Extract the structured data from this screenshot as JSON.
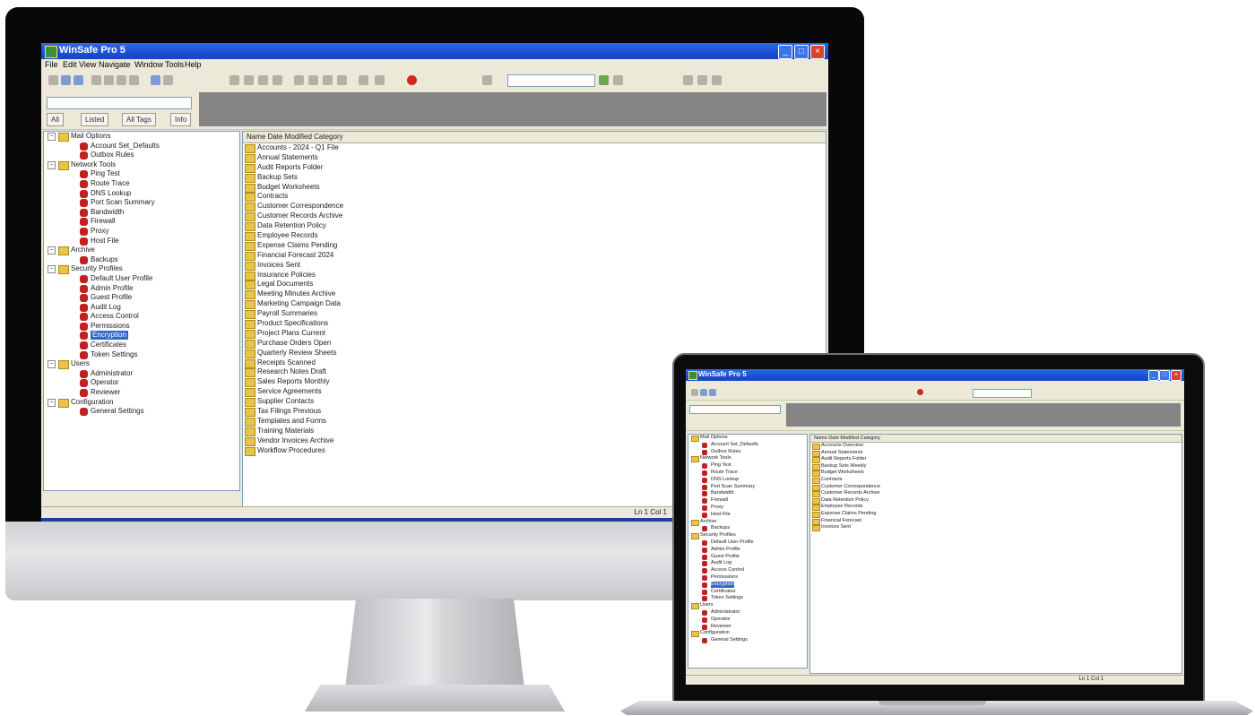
{
  "window": {
    "title": "WinSafe Pro 5"
  },
  "menu": [
    "File",
    "Edit",
    "View",
    "Navigate",
    "Window",
    "Tools",
    "Help"
  ],
  "toolbar": {
    "accent_colors": {
      "record": "#d6261f",
      "title_bar": "#1a4fd2",
      "selection": "#316ac5"
    }
  },
  "search": {
    "placeholder": "",
    "value": ""
  },
  "tabs": [
    "All",
    "Listed",
    "All Tags",
    "Info"
  ],
  "list_header": "Name    Date Modified    Category",
  "status": {
    "text": "Ln 1  Col 1"
  },
  "tree": [
    {
      "type": "folder",
      "level": 0,
      "label": "Mail Options"
    },
    {
      "type": "item",
      "level": 1,
      "label": "Account Set_Defaults"
    },
    {
      "type": "item",
      "level": 1,
      "label": "Outbox Rules"
    },
    {
      "type": "folder",
      "level": 0,
      "label": "Network Tools"
    },
    {
      "type": "item",
      "level": 1,
      "label": "Ping Test"
    },
    {
      "type": "item",
      "level": 1,
      "label": "Route Trace"
    },
    {
      "type": "item",
      "level": 1,
      "label": "DNS Lookup"
    },
    {
      "type": "item",
      "level": 1,
      "label": "Port Scan Summary"
    },
    {
      "type": "item",
      "level": 1,
      "label": "Bandwidth"
    },
    {
      "type": "item",
      "level": 1,
      "label": "Firewall"
    },
    {
      "type": "item",
      "level": 1,
      "label": "Proxy"
    },
    {
      "type": "item",
      "level": 1,
      "label": "Host File"
    },
    {
      "type": "folder",
      "level": 0,
      "label": "Archive"
    },
    {
      "type": "item",
      "level": 1,
      "label": "Backups"
    },
    {
      "type": "folder",
      "level": 0,
      "label": "Security Profiles"
    },
    {
      "type": "item",
      "level": 1,
      "label": "Default User Profile"
    },
    {
      "type": "item",
      "level": 1,
      "label": "Admin Profile"
    },
    {
      "type": "item",
      "level": 1,
      "label": "Guest Profile"
    },
    {
      "type": "item",
      "level": 1,
      "label": "Audit Log"
    },
    {
      "type": "item",
      "level": 1,
      "label": "Access Control"
    },
    {
      "type": "item",
      "level": 1,
      "label": "Permissions"
    },
    {
      "type": "item",
      "level": 1,
      "label": "Encryption",
      "selected": true
    },
    {
      "type": "item",
      "level": 1,
      "label": "Certificates"
    },
    {
      "type": "item",
      "level": 1,
      "label": "Token Settings"
    },
    {
      "type": "folder",
      "level": 0,
      "label": "Users"
    },
    {
      "type": "item",
      "level": 1,
      "label": "Administrator"
    },
    {
      "type": "item",
      "level": 1,
      "label": "Operator"
    },
    {
      "type": "item",
      "level": 1,
      "label": "Reviewer"
    },
    {
      "type": "folder",
      "level": 0,
      "label": "Configuration"
    },
    {
      "type": "item",
      "level": 1,
      "label": "General Settings"
    }
  ],
  "list": [
    "Accounts - 2024 - Q1 File",
    "Annual Statements",
    "Audit Reports Folder",
    "Backup Sets",
    "Budget Worksheets",
    "Contracts",
    "Customer Correspondence",
    "Customer Records Archive",
    "Data Retention Policy",
    "Employee Records",
    "Expense Claims Pending",
    "Financial Forecast 2024",
    "Invoices Sent",
    "Insurance Policies",
    "Legal Documents",
    "Meeting Minutes Archive",
    "Marketing Campaign Data",
    "Payroll Summaries",
    "Product Specifications",
    "Project Plans Current",
    "Purchase Orders Open",
    "Quarterly Review Sheets",
    "Receipts Scanned",
    "Research Notes Draft",
    "Sales Reports Monthly",
    "Service Agreements",
    "Supplier Contacts",
    "Tax Filings Previous",
    "Templates and Forms",
    "Training Materials",
    "Vendor Invoices Archive",
    "Workflow Procedures"
  ],
  "laptop_list": [
    "Accounts Overview",
    "Annual Statements",
    "Audit Reports Folder",
    "Backup Sets Weekly",
    "Budget Worksheets",
    "Contracts",
    "Customer Correspondence",
    "Customer Records Archive",
    "Data Retention Policy",
    "Employee Records",
    "Expense Claims Pending",
    "Financial Forecast",
    "Invoices Sent"
  ]
}
